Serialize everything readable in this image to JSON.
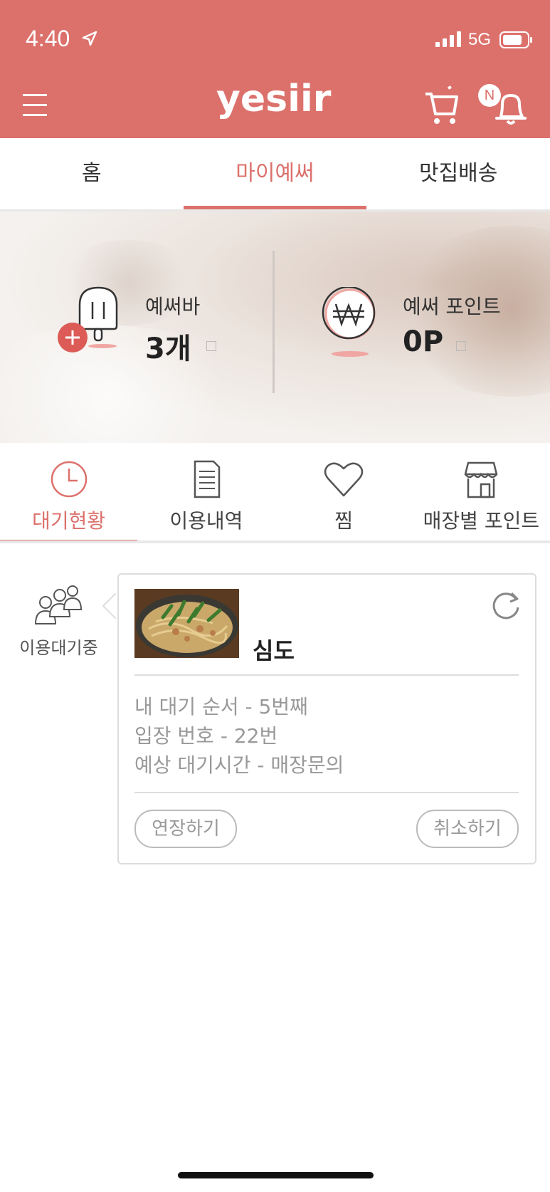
{
  "status_bar": {
    "time": "4:40",
    "network": "5G"
  },
  "header": {
    "logo_text": "yesiir",
    "notification_badge": "N",
    "brand_color": "#dc716c"
  },
  "main_tabs": [
    {
      "label": "홈",
      "active": false
    },
    {
      "label": "마이예써",
      "active": true
    },
    {
      "label": "맛집배송",
      "active": false
    }
  ],
  "hero": {
    "bar": {
      "label": "예써바",
      "value": "3개"
    },
    "points": {
      "label": "예써 포인트",
      "value": "0P"
    }
  },
  "sub_tabs": [
    {
      "label": "대기현황",
      "icon": "clock-icon",
      "active": true
    },
    {
      "label": "이용내역",
      "icon": "document-icon",
      "active": false
    },
    {
      "label": "찜",
      "icon": "heart-icon",
      "active": false
    },
    {
      "label": "매장별 포인트",
      "icon": "store-icon",
      "active": false
    }
  ],
  "waiting": {
    "side_label": "이용대기중",
    "store_name": "심도",
    "lines": [
      "내 대기 순서 - 5번째",
      "입장 번호 - 22번",
      "예상 대기시간 - 매장문의"
    ],
    "extend_label": "연장하기",
    "cancel_label": "취소하기"
  }
}
